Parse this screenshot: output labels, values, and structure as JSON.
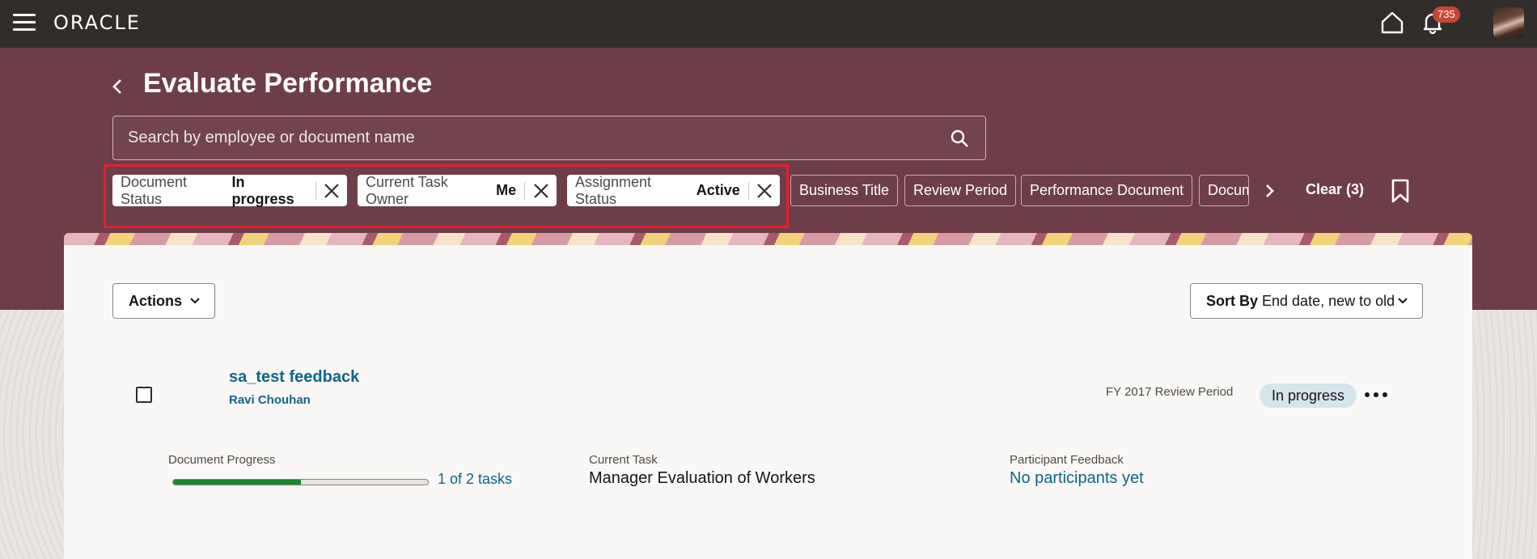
{
  "header": {
    "logo": "ORACLE",
    "notification_count": "735"
  },
  "page": {
    "title": "Evaluate Performance",
    "search_placeholder": "Search by employee or document name"
  },
  "filters": {
    "applied": [
      {
        "label": "Document Status",
        "value": "In progress"
      },
      {
        "label": "Current Task Owner",
        "value": "Me"
      },
      {
        "label": "Assignment Status",
        "value": "Active"
      }
    ],
    "available": [
      "Business Title",
      "Review Period",
      "Performance Document",
      "Document"
    ],
    "clear_label": "Clear (3)"
  },
  "toolbar": {
    "actions_label": "Actions",
    "sort_prefix": "Sort By",
    "sort_value": "End date, new to old"
  },
  "document": {
    "title": "sa_test feedback",
    "owner": "Ravi Chouhan",
    "period": "FY 2017 Review Period",
    "status": "In progress",
    "progress_label": "Document Progress",
    "progress_fraction": 0.5,
    "progress_text": "1 of 2 tasks",
    "current_task_label": "Current Task",
    "current_task": "Manager Evaluation of Workers",
    "participants_label": "Participant Feedback",
    "participants_value": "No participants yet"
  },
  "colors": {
    "header_bg": "#312d2a",
    "hero_bg": "#6e3e48",
    "link": "#0e6687",
    "progress": "#178a2b",
    "badge": "#c74634",
    "highlight": "#e5202e"
  }
}
